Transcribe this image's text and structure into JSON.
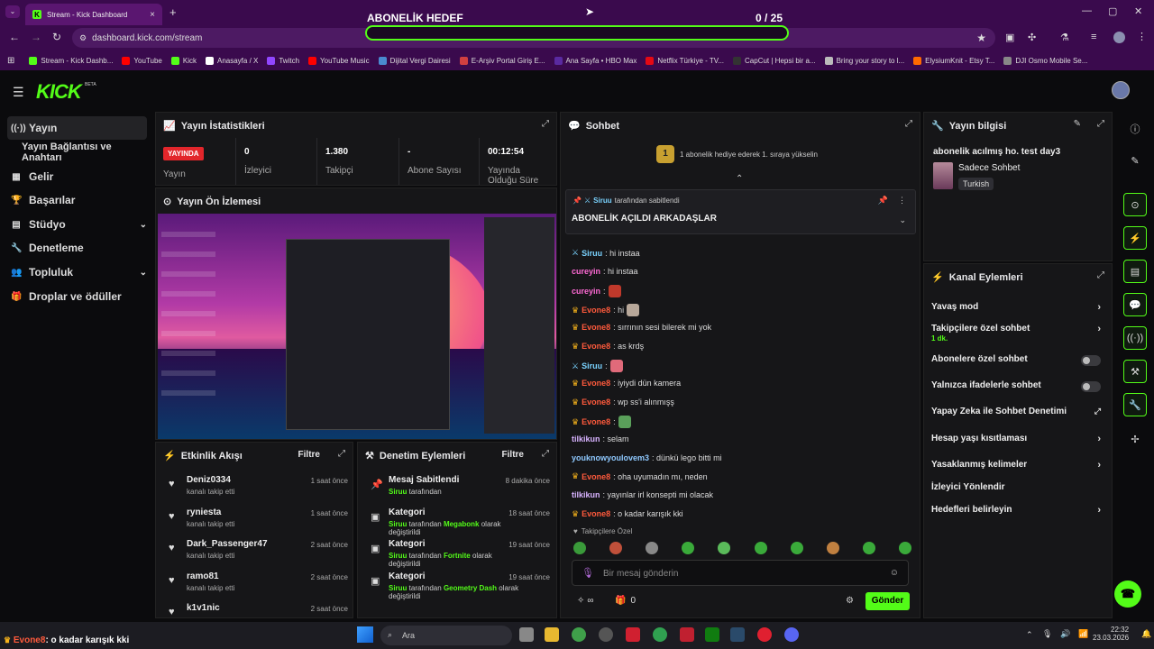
{
  "browser": {
    "tab_title": "Stream - Kick Dashboard",
    "tab_close": "×",
    "new_tab": "+",
    "tab_list": "⌄",
    "window_controls": [
      "—",
      "▢",
      "✕"
    ],
    "url": "dashboard.kick.com/stream",
    "bookmarks": [
      "Stream - Kick Dashb...",
      "YouTube",
      "Kick",
      "Anasayfa / X",
      "Twitch",
      "YouTube Music",
      "Dijital Vergi Dairesi",
      "E-Arşiv Portal Giriş E...",
      "Ana Sayfa • HBO Max",
      "Netflix Türkiye - TV...",
      "CapCut | Hepsi bir a...",
      "Bring your story to l...",
      "ElysiumKnit - Etsy T...",
      "DJI Osmo Mobile Se..."
    ]
  },
  "overlay": {
    "goal_title": "ABONELİK HEDEF",
    "goal_count": "0  / 25",
    "goal_progress": 0
  },
  "brand": {
    "logo": "KICK",
    "beta": "BETA"
  },
  "sidebar": {
    "items": [
      {
        "label": "Yayın",
        "icon": "((·))"
      },
      {
        "label": "Yayın Bağlantısı ve Anahtarı",
        "icon": ""
      },
      {
        "label": "Gelir",
        "icon": "▦"
      },
      {
        "label": "Başarılar",
        "icon": "🏆"
      },
      {
        "label": "Stüdyo",
        "icon": "▤",
        "chev": "⌄"
      },
      {
        "label": "Denetleme",
        "icon": "🔧"
      },
      {
        "label": "Topluluk",
        "icon": "👥",
        "chev": "⌄"
      },
      {
        "label": "Droplar ve ödüller",
        "icon": "🎁"
      }
    ]
  },
  "stats": {
    "title": "Yayın İstatistikleri",
    "live_badge": "YAYINDA",
    "items": [
      {
        "value": "",
        "label": "Yayın"
      },
      {
        "value": "0",
        "label": "İzleyici"
      },
      {
        "value": "1.380",
        "label": "Takipçi"
      },
      {
        "value": "-",
        "label": "Abone Sayısı"
      },
      {
        "value": "00:12:54",
        "label": "Yayında Olduğu Süre"
      }
    ]
  },
  "preview": {
    "title": "Yayın Ön İzlemesi"
  },
  "activity": {
    "title": "Etkinlik Akışı",
    "filter": "Filtre",
    "rows": [
      {
        "name": "Deniz0334",
        "sub": "kanalı takip etti",
        "time": "1 saat önce"
      },
      {
        "name": "ryniesta",
        "sub": "kanalı takip etti",
        "time": "1 saat önce"
      },
      {
        "name": "Dark_Passenger47",
        "sub": "kanalı takip etti",
        "time": "2 saat önce"
      },
      {
        "name": "ramo81",
        "sub": "kanalı takip etti",
        "time": "2 saat önce"
      },
      {
        "name": "k1v1nic",
        "sub": "",
        "time": "2 saat önce"
      }
    ]
  },
  "mod": {
    "title": "Denetim Eylemleri",
    "filter": "Filtre",
    "rows": [
      {
        "name": "Mesaj Sabitlendi",
        "user": "Siruu",
        "mid": " tarafından",
        "target": "",
        "tail": "",
        "time": "8 dakika önce"
      },
      {
        "name": "Kategori",
        "user": "Siruu",
        "mid": " tarafından ",
        "target": "Megabonk",
        "tail": " olarak değiştirildi",
        "time": "18 saat önce"
      },
      {
        "name": "Kategori",
        "user": "Siruu",
        "mid": " tarafından ",
        "target": "Fortnite",
        "tail": " olarak değiştirildi",
        "time": "19 saat önce"
      },
      {
        "name": "Kategori",
        "user": "Siruu",
        "mid": " tarafından ",
        "target": "Geometry Dash",
        "tail": " olarak değiştirildi",
        "time": "19 saat önce"
      }
    ]
  },
  "chat": {
    "title": "Sohbet",
    "gift_text": "1 abonelik hediye ederek 1. sıraya yükselin",
    "gift_rank": "1",
    "pinned_by_user": "Siruu",
    "pinned_by": " tarafından sabitlendi",
    "pinned_message": "ABONELİK AÇILDI ARKADAŞLAR",
    "messages": [
      {
        "user": "Siruu",
        "cls": "u-bl",
        "badge": "mod",
        "text": ": hi instaa"
      },
      {
        "user": "cureyin",
        "cls": "u-pk",
        "badge": "",
        "text": ": hi instaa"
      },
      {
        "user": "cureyin",
        "cls": "u-pk",
        "badge": "",
        "text": ":",
        "emote": "#c0392b"
      },
      {
        "user": "Evone8",
        "cls": "u-or",
        "badge": "crown",
        "text": ": hi",
        "emote": "#b8a89a"
      },
      {
        "user": "Evone8",
        "cls": "u-or",
        "badge": "crown",
        "text": ": sırrının sesi bilerek mi yok"
      },
      {
        "user": "Evone8",
        "cls": "u-or",
        "badge": "crown",
        "text": ": as krdş"
      },
      {
        "user": "Siruu",
        "cls": "u-bl",
        "badge": "mod",
        "text": ":",
        "emote": "#e06a7a"
      },
      {
        "user": "Evone8",
        "cls": "u-or",
        "badge": "crown",
        "text": ": iyiydi dün kamera"
      },
      {
        "user": "Evone8",
        "cls": "u-or",
        "badge": "crown",
        "text": ": wp ss'i alınmışş"
      },
      {
        "user": "Evone8",
        "cls": "u-or",
        "badge": "crown",
        "text": ":",
        "emote": "#5aa05a"
      },
      {
        "user": "tilkikun",
        "cls": "u-lv",
        "badge": "",
        "text": ": selam"
      },
      {
        "user": "youknowyoulovem3",
        "cls": "u-cy",
        "badge": "",
        "text": ": dünkü lego bitti mi"
      },
      {
        "user": "Evone8",
        "cls": "u-or",
        "badge": "crown",
        "text": ": oha uyumadın mı, neden"
      },
      {
        "user": "tilkikun",
        "cls": "u-lv",
        "badge": "",
        "text": ": yayınlar irl konsepti mi olacak"
      },
      {
        "user": "Evone8",
        "cls": "u-or",
        "badge": "crown",
        "text": ": o kadar karışık kki"
      }
    ],
    "followers_only": "Takipçilere Özel",
    "input_placeholder": "Bir mesaj gönderin",
    "points": "∞",
    "gifts": "0",
    "send": "Gönder"
  },
  "info": {
    "title": "Yayın bilgisi",
    "stream_title": "abonelik acılmış ho. test day3",
    "category": "Sadece Sohbet",
    "tag": "Turkish"
  },
  "channel": {
    "title": "Kanal Eylemleri",
    "rows": [
      {
        "label": "Yavaş mod",
        "ctl": "chev"
      },
      {
        "label": "Takipçilere özel sohbet",
        "sub": "1 dk.",
        "ctl": "chev"
      },
      {
        "label": "Abonelere özel sohbet",
        "ctl": "toggle"
      },
      {
        "label": "Yalnızca ifadelerle sohbet",
        "ctl": "toggle"
      },
      {
        "label": "Yapay Zeka ile Sohbet Denetimi",
        "ctl": "ext"
      },
      {
        "label": "Hesap yaşı kısıtlaması",
        "ctl": "chev"
      },
      {
        "label": "Yasaklanmış kelimeler",
        "ctl": "chev"
      },
      {
        "label": "İzleyici Yönlendir",
        "ctl": ""
      },
      {
        "label": "Hedefleri belirleyin",
        "ctl": "chev"
      }
    ]
  },
  "ticker": {
    "user": "Evone8",
    "text": ": o kadar karışık kki"
  },
  "taskbar": {
    "search": "Ara",
    "time": "22:32",
    "date": "23.03.2026"
  },
  "colors": {
    "accent": "#53fc18",
    "live": "#e2262b",
    "chrome": "#3a0a4d"
  }
}
